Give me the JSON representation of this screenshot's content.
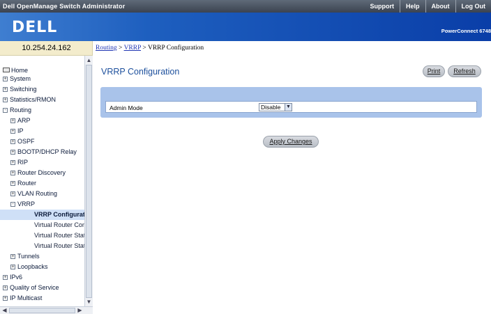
{
  "topbar": {
    "title": "Dell OpenManage Switch Administrator",
    "links": [
      "Support",
      "Help",
      "About",
      "Log Out"
    ]
  },
  "banner": {
    "logo": "DELL",
    "model": "PowerConnect 6748"
  },
  "ip": "10.254.24.162",
  "breadcrumb": {
    "first": "Routing",
    "sep1": " > ",
    "second": "VRRP",
    "sep2": " > ",
    "current": "VRRP Configuration"
  },
  "sidebar": {
    "nodes": [
      {
        "label": "Home",
        "marker": "folder"
      },
      {
        "label": "System",
        "marker": "+"
      },
      {
        "label": "Switching",
        "marker": "+"
      },
      {
        "label": "Statistics/RMON",
        "marker": "+"
      },
      {
        "label": "Routing",
        "marker": "-"
      },
      {
        "label": "ARP",
        "marker": "+"
      },
      {
        "label": "IP",
        "marker": "+"
      },
      {
        "label": "OSPF",
        "marker": "+"
      },
      {
        "label": "BOOTP/DHCP Relay",
        "marker": "+"
      },
      {
        "label": "RIP",
        "marker": "+"
      },
      {
        "label": "Router Discovery",
        "marker": "+"
      },
      {
        "label": "Router",
        "marker": "+"
      },
      {
        "label": "VLAN Routing",
        "marker": "+"
      },
      {
        "label": "VRRP",
        "marker": "-"
      },
      {
        "label": "VRRP Configurat",
        "marker": ""
      },
      {
        "label": "Virtual Router Con",
        "marker": ""
      },
      {
        "label": "Virtual Router Stat",
        "marker": ""
      },
      {
        "label": "Virtual Router Stat",
        "marker": ""
      },
      {
        "label": "Tunnels",
        "marker": "+"
      },
      {
        "label": "Loopbacks",
        "marker": "+"
      },
      {
        "label": "IPv6",
        "marker": "+"
      },
      {
        "label": "Quality of Service",
        "marker": "+"
      },
      {
        "label": "IP Multicast",
        "marker": "+"
      }
    ],
    "selected_label": "VRRP Configurat"
  },
  "main": {
    "title": "VRRP Configuration",
    "print_label": "Print",
    "refresh_label": "Refresh",
    "admin_mode_label": "Admin Mode",
    "admin_mode_value": "Disable",
    "apply_label": "Apply Changes"
  },
  "colors": {
    "title_blue": "#1c4f9c",
    "panel_blue": "#a9c3ea",
    "banner_blue": "#1e5fbf",
    "selected_row": "#cfe0f7",
    "ip_background": "#f3eccc"
  },
  "icons": {
    "home": "folder-icon",
    "expand": "plus-box-icon",
    "collapse": "minus-box-icon",
    "dropdown": "chevron-down-icon"
  }
}
